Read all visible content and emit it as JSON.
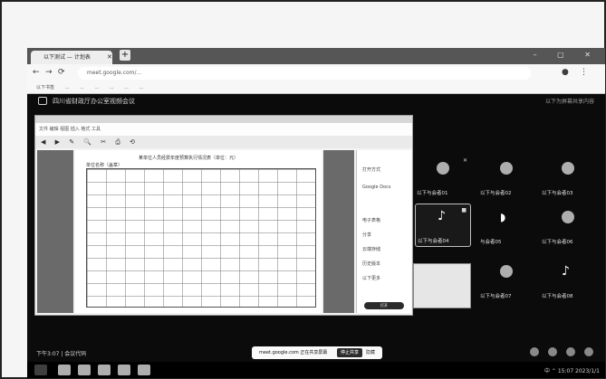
{
  "browser": {
    "tab_title": "以下测试 — 计划表",
    "new_tab": "+",
    "url": "meet.google.com/...",
    "bookmarks": [
      "以下书签",
      "...",
      "...",
      "...",
      "...",
      "...",
      "..."
    ]
  },
  "meet": {
    "title": "四川省财政厅办公室视频会议",
    "right_text": "以下为屏幕共享内容"
  },
  "shared_doc": {
    "menu": "文件 编辑 视图 插入 格式 工具",
    "toolbar": "◀ ▶ ✎ 🔍 ✂ ⎙ ⟲",
    "title": "某单位人员经费年度预算执行情况表（单位：元）",
    "org": "单位名称（盖章）",
    "side_items": [
      "打开方式",
      "Google Docs",
      "电子表格",
      "分享",
      "云端存储",
      "历史版本",
      "以下更多"
    ],
    "side_button": "打开"
  },
  "participants": [
    {
      "name": "以下与会者01"
    },
    {
      "name": "以下与会者02"
    },
    {
      "name": "以下与会者03"
    },
    {
      "name": "以下与会者04"
    },
    {
      "name": "与会者05"
    },
    {
      "name": "以下与会者06"
    },
    {
      "name": "以下与会者07"
    },
    {
      "name": "以下与会者08"
    }
  ],
  "bottom": {
    "clock": "下午3:07 | 会议代码",
    "toast_text": "meet.google.com 正在共享屏幕",
    "stop_label": "停止共享",
    "hide_label": "隐藏"
  },
  "taskbar": {
    "tray": "中 ⌃ 15:07 2023/1/1"
  }
}
